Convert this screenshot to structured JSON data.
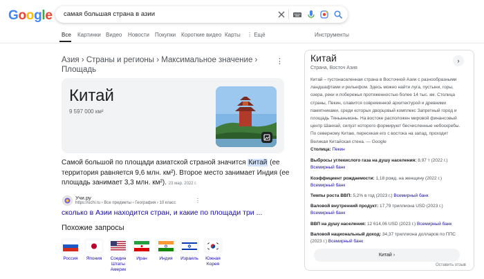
{
  "header": {
    "logo_letters": [
      "G",
      "o",
      "o",
      "g",
      "l",
      "e"
    ],
    "logo_colors": [
      "#4285f4",
      "#ea4335",
      "#fbbc05",
      "#4285f4",
      "#34a853",
      "#ea4335"
    ],
    "query": "самая большая страна в азии",
    "icons": [
      "close-icon",
      "keyboard-icon",
      "microphone-icon",
      "lens-icon",
      "search-icon"
    ]
  },
  "tabs": {
    "items": [
      "Все",
      "Картинки",
      "Видео",
      "Новости",
      "Покупки",
      "Короткие видео",
      "Карты",
      "⋮ Ещё"
    ],
    "tools": "Инструменты",
    "active_index": 0
  },
  "breadcrumb": "Азия › Страны и регионы › Максимальное значение › Площадь",
  "card": {
    "title": "Китай",
    "value": "9 597 000 км²"
  },
  "answer": {
    "before": "Самой большой по площади азиатской страной значится ",
    "highlight": "Китай",
    "after": " (ее территория равняется 9,6 млн. км²). Второе место занимает Индия (ее площадь занимает 3,3 млн. км²).",
    "date": "23 мар. 2022 г."
  },
  "source": {
    "name": "Учи.ру",
    "url": "https://uchi.ru › Все предметы › География › 10 класс",
    "link": "сколько в Азии находится стран, и какие по площади три ..."
  },
  "related": {
    "title": "Похожие запросы",
    "items": [
      {
        "label": "Россия"
      },
      {
        "label": "Япония"
      },
      {
        "label": "Соедин Штаты Америк"
      },
      {
        "label": "Иран"
      },
      {
        "label": "Индия"
      },
      {
        "label": "Израиль"
      },
      {
        "label": "Южная Корея"
      }
    ]
  },
  "panel": {
    "title": "Китай",
    "subtitle": "Страна, Восточ Азия",
    "description": "Китай – густонаселенная страна в Восточной Азии с разнообразными ландшафтами и рельефом. Здесь можно найти луга, пустыни, горы, озера, реки и побережья протяженностью более 14 тыс. км. Столица страны, Пекин, славится современной архитектурой и древними памятниками, среди которых дворцовый комплекс Запретный город и площадь Тяньаньмэнь. На востоке расположен мировой финансовый центр Шанхай, силуэт которого формируют бесчисленные небоскребы. По северному Китаю, пересекая его с востока на запад, проходит Великая Китайская стена. — Google",
    "facts": [
      {
        "label": "Столица:",
        "value": " ",
        "link": "Пекин",
        "source": ""
      },
      {
        "label": "Выбросы углекислого газа на душу населения:",
        "value": " 8,97 т (2022 г.)",
        "link": "",
        "source": "Всемирный банк"
      },
      {
        "label": "Коэффициент рождаемости:",
        "value": " 1,18 рожд. на женщину (2022 г.)",
        "link": "",
        "source": "Всемирный банк"
      },
      {
        "label": "Темпы роста ВВП:",
        "value": " 5,2% в год (2023 г.) ",
        "link": "Всемирный банк",
        "source": ""
      },
      {
        "label": "Валовой внутренний продукт:",
        "value": " 17,79 триллиона USD (2023 г.)",
        "link": "",
        "source": "Всемирный банк"
      },
      {
        "label": "ВВП на душу населения:",
        "value": " 12 614,06 USD (2023 г.) ",
        "link": "Всемирный банк",
        "source": ""
      },
      {
        "label": "Валовой национальный доход:",
        "value": " 34,37 триллиона долларов по ППС (2023 г.) ",
        "link": "Всемирный банк",
        "source": ""
      }
    ],
    "button": "Китай",
    "feedback": "Оставить отзыв"
  }
}
